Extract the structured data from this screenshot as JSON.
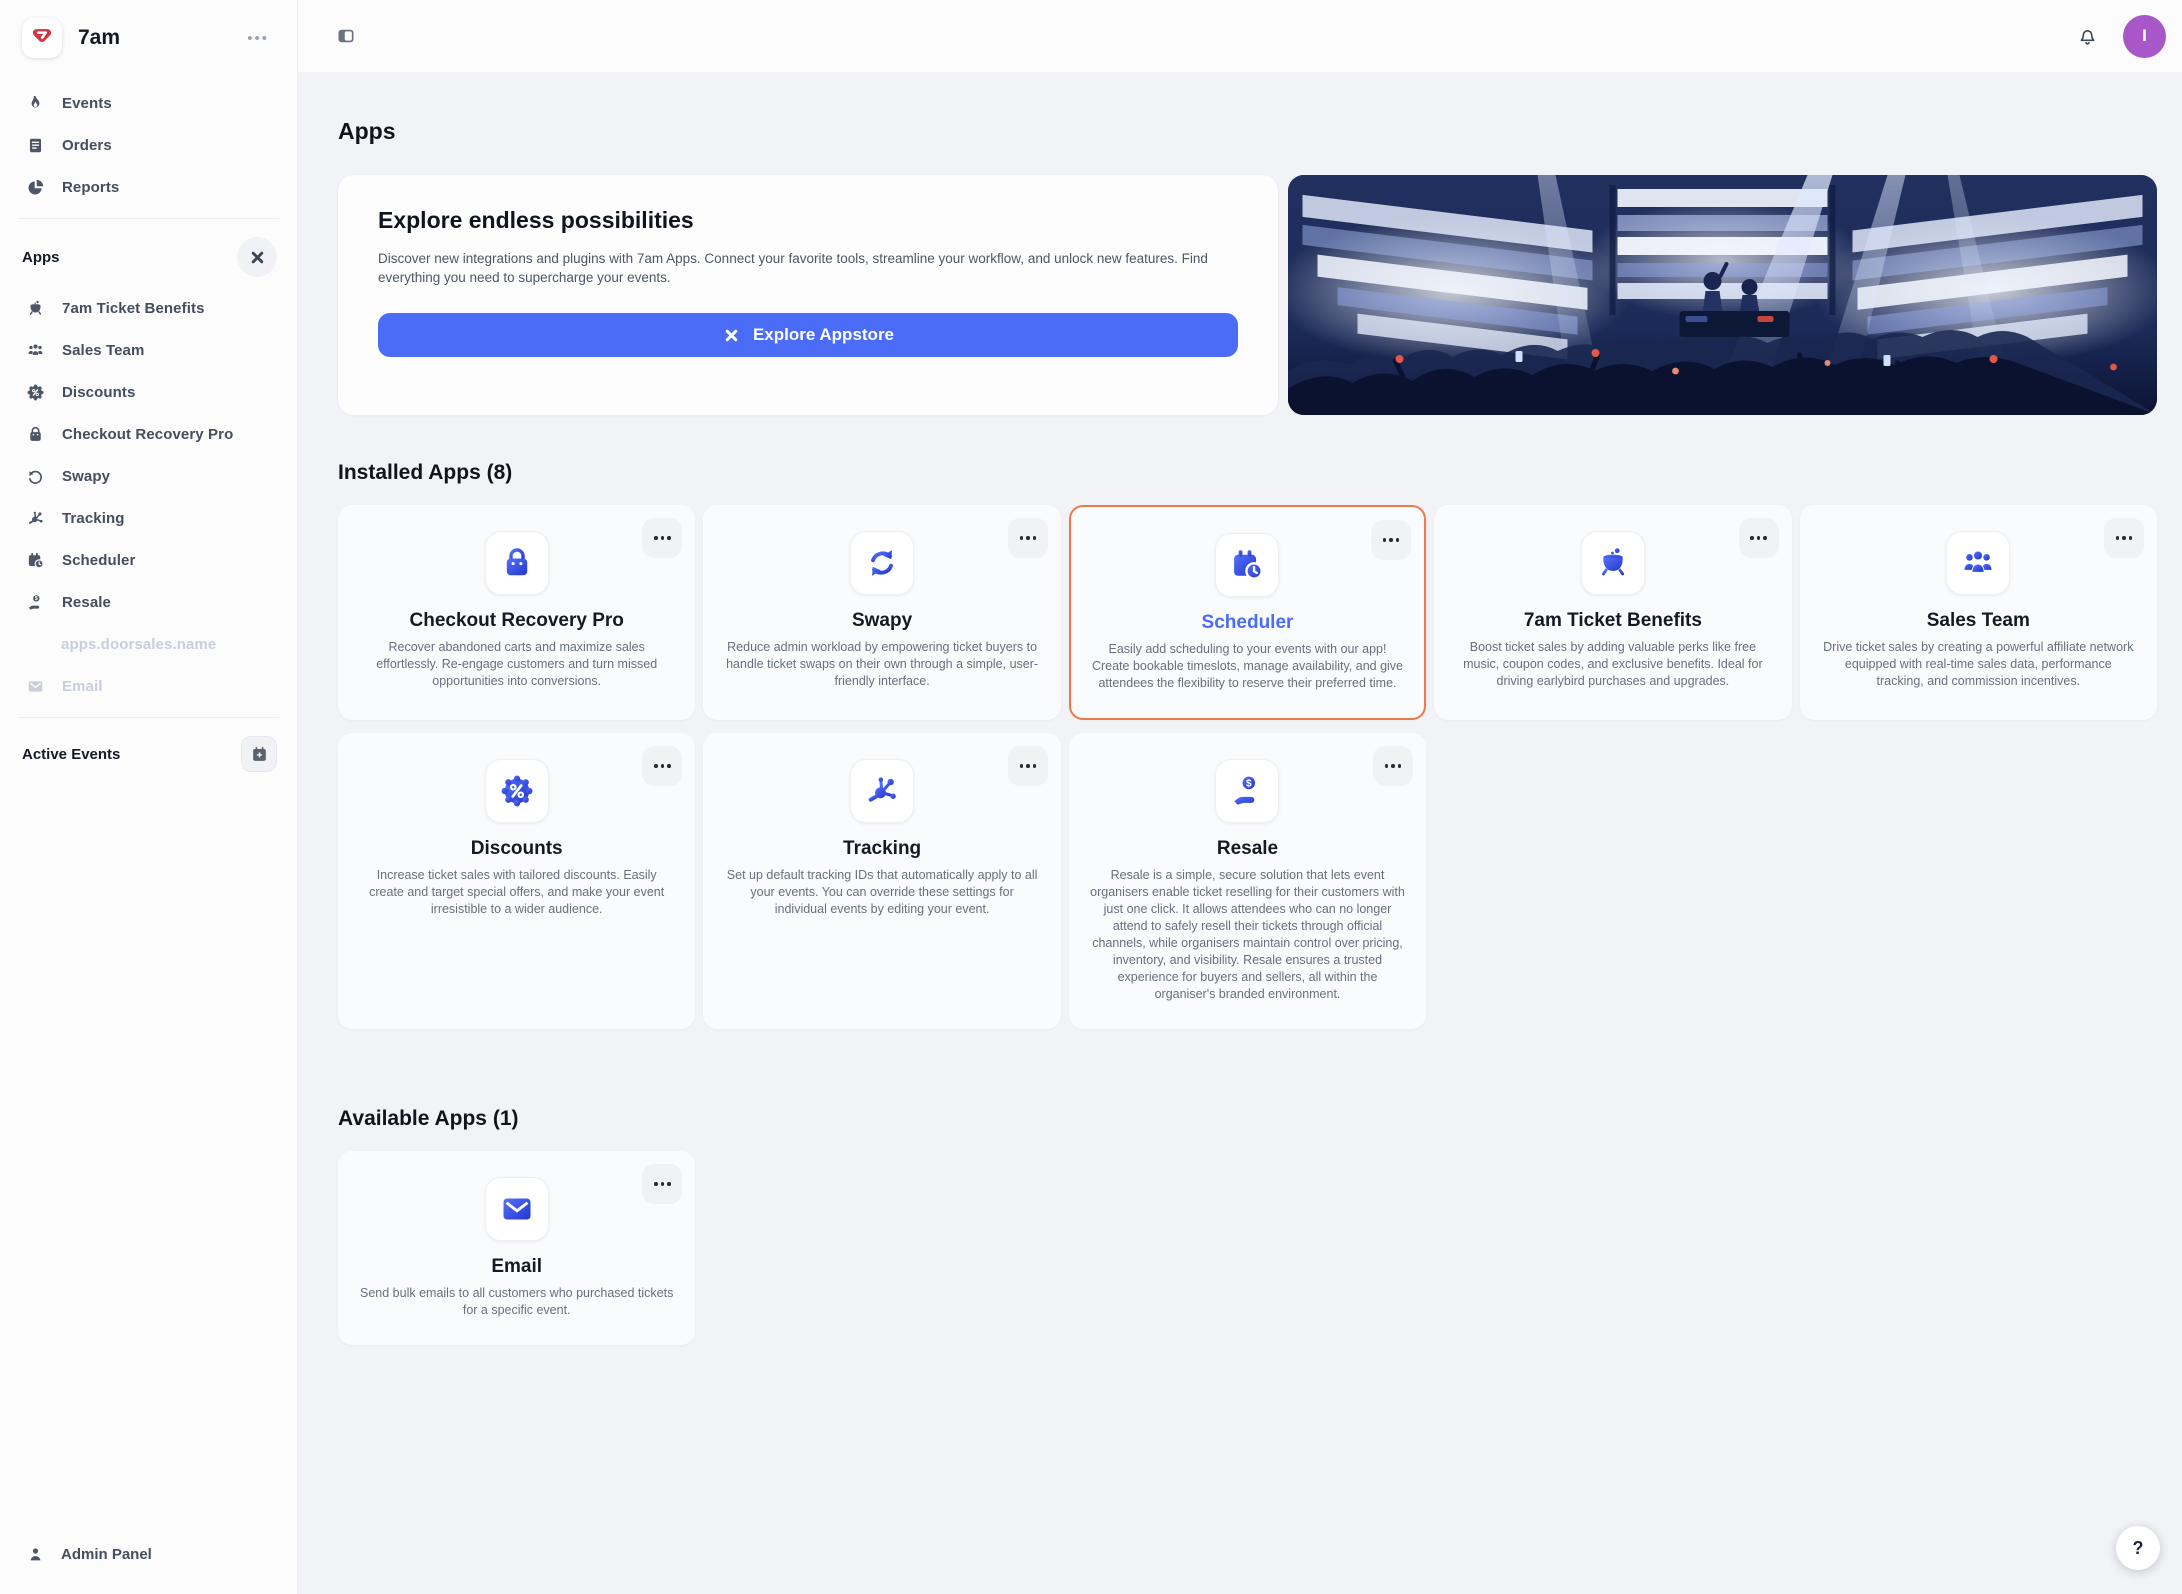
{
  "brand": {
    "name": "7am"
  },
  "topbar": {
    "avatar_initial": "I"
  },
  "sidebar": {
    "nav": [
      {
        "label": "Events"
      },
      {
        "label": "Orders"
      },
      {
        "label": "Reports"
      }
    ],
    "apps_header": "Apps",
    "apps": [
      {
        "label": "7am Ticket Benefits"
      },
      {
        "label": "Sales Team"
      },
      {
        "label": "Discounts"
      },
      {
        "label": "Checkout Recovery Pro"
      },
      {
        "label": "Swapy"
      },
      {
        "label": "Tracking"
      },
      {
        "label": "Scheduler"
      },
      {
        "label": "Resale"
      },
      {
        "label": "apps.doorsales.name"
      },
      {
        "label": "Email"
      }
    ],
    "active_events_header": "Active Events",
    "admin_label": "Admin Panel"
  },
  "page": {
    "title": "Apps"
  },
  "hero": {
    "title": "Explore endless possibilities",
    "description": "Discover new integrations and plugins with 7am Apps. Connect your favorite tools, streamline your workflow, and unlock new features. Find everything you need to supercharge your events.",
    "button_label": "Explore Appstore"
  },
  "installed_section": {
    "title": "Installed Apps (8)"
  },
  "available_section": {
    "title": "Available Apps (1)"
  },
  "installed_apps": [
    {
      "name": "Checkout Recovery Pro",
      "icon": "shopping-bag-icon",
      "description": "Recover abandoned carts and maximize sales effortlessly. Re-engage customers and turn missed opportunities into conversions."
    },
    {
      "name": "Swapy",
      "icon": "sync-arrows-icon",
      "description": "Reduce admin workload by empowering ticket buyers to handle ticket swaps on their own through a simple, user-friendly interface."
    },
    {
      "name": "Scheduler",
      "icon": "calendar-clock-icon",
      "highlighted": true,
      "description": "Easily add scheduling to your events with our app! Create bookable timeslots, manage availability, and give attendees the flexibility to reserve their preferred time."
    },
    {
      "name": "7am Ticket Benefits",
      "icon": "cauldron-icon",
      "description": "Boost ticket sales by adding valuable perks like free music, coupon codes, and exclusive benefits. Ideal for driving earlybird purchases and upgrades."
    },
    {
      "name": "Sales Team",
      "icon": "team-icon",
      "description": "Drive ticket sales by creating a powerful affiliate network equipped with real-time sales data, performance tracking, and commission incentives."
    },
    {
      "name": "Discounts",
      "icon": "discount-badge-icon",
      "description": "Increase ticket sales with tailored discounts. Easily create and target special offers, and make your event irresistible to a wider audience."
    },
    {
      "name": "Tracking",
      "icon": "tracking-node-icon",
      "description": "Set up default tracking IDs that automatically apply to all your events. You can override these settings for individual events by editing your event."
    },
    {
      "name": "Resale",
      "icon": "hand-dollar-icon",
      "description": "Resale is a simple, secure solution that lets event organisers enable ticket reselling for their customers with just one click. It allows attendees who can no longer attend to safely resell their tickets through official channels, while organisers maintain control over pricing, inventory, and visibility. Resale ensures a trusted experience for buyers and sellers, all within the organiser's branded environment."
    }
  ],
  "available_apps": [
    {
      "name": "Email",
      "icon": "envelope-icon",
      "description": "Send bulk emails to all customers who purchased tickets for a specific event."
    }
  ],
  "help_button": {
    "label": "?"
  },
  "colors": {
    "accent_blue": "#4a6cf7",
    "highlight_orange": "#ec7a4d",
    "avatar_purple": "#a757c8",
    "icon_blue_dark": "#2336cc",
    "icon_blue_light": "#5472f8"
  }
}
